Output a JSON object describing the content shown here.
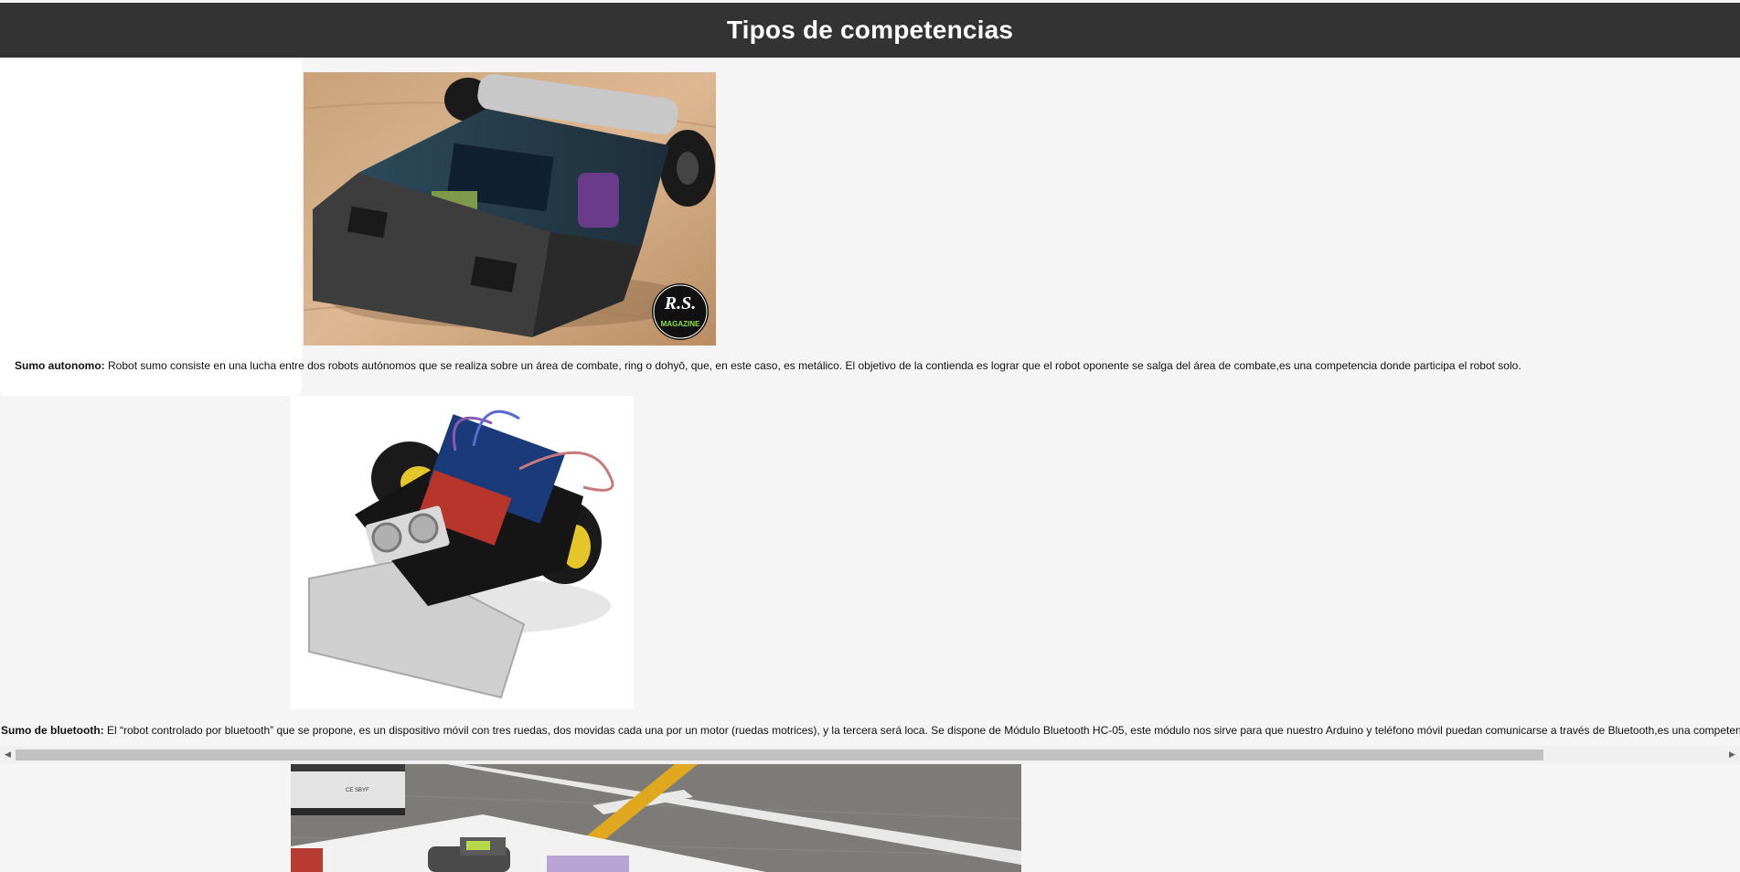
{
  "header": {
    "title": "Tipos de competencias"
  },
  "competitions": [
    {
      "name": "Sumo autonomo:",
      "description": "Robot sumo consiste en una lucha entre dos robots autónomos que se realiza sobre un área de combate, ring o dohyō, que, en este caso, es metálico. El objetivo de la contienda es lograr que el robot oponente se salga del área de combate,es una competencia donde participa el robot solo.",
      "image_icon": "sumo-robot-photo",
      "watermark": "RS MAGAZINE"
    },
    {
      "name": "Sumo de bluetooth:",
      "description": "El “robot controlado por bluetooth” que se propone, es un dispositivo móvil con tres ruedas, dos movidas cada una por un motor (ruedas motrices), y la tercera será loca. Se dispone de Módulo Bluetooth HC-05, este módulo nos sirve para que nuestro Arduino y teléfono móvil puedan comunicarse a través de Bluetooth,es una competencia",
      "image_icon": "bluetooth-robot-photo"
    },
    {
      "image_icon": "line-follower-track-photo"
    }
  ],
  "scrollbar": {
    "left_arrow": "◀",
    "right_arrow": "▶"
  },
  "colors": {
    "header_bg": "#333333",
    "page_bg": "#f5f5f5",
    "card_bg": "#ffffff"
  }
}
